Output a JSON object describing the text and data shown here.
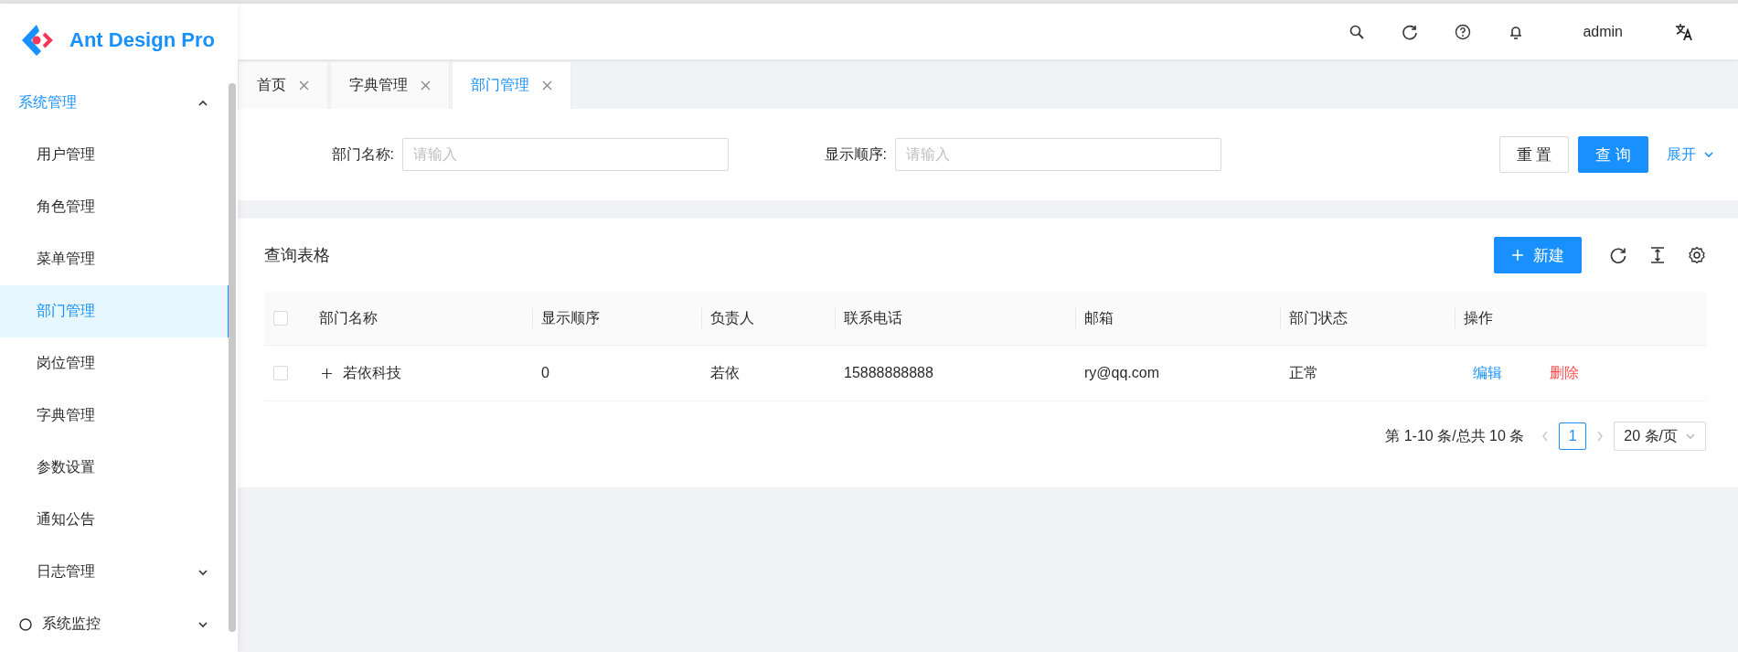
{
  "sidebar": {
    "logo_text": "Ant Design Pro",
    "menu": [
      {
        "label": "系统管理",
        "expanded": true,
        "children": [
          {
            "label": "用户管理",
            "selected": false
          },
          {
            "label": "角色管理",
            "selected": false
          },
          {
            "label": "菜单管理",
            "selected": false
          },
          {
            "label": "部门管理",
            "selected": true
          },
          {
            "label": "岗位管理",
            "selected": false
          },
          {
            "label": "字典管理",
            "selected": false
          },
          {
            "label": "参数设置",
            "selected": false
          },
          {
            "label": "通知公告",
            "selected": false
          },
          {
            "label": "日志管理",
            "selected": false,
            "expanded": false
          }
        ]
      },
      {
        "label": "系统监控",
        "expanded": false
      }
    ]
  },
  "header": {
    "user": "admin"
  },
  "tabs": [
    {
      "label": "首页",
      "selected": false
    },
    {
      "label": "字典管理",
      "selected": false
    },
    {
      "label": "部门管理",
      "selected": true
    }
  ],
  "search_form": {
    "fields": [
      {
        "label": "部门名称:",
        "placeholder": "请输入"
      },
      {
        "label": "显示顺序:",
        "placeholder": "请输入"
      }
    ],
    "reset_button": "重 置",
    "query_button": "查 询",
    "expand_link": "展开"
  },
  "table_card": {
    "title": "查询表格",
    "new_button": "新建",
    "columns": [
      "部门名称",
      "显示顺序",
      "负责人",
      "联系电话",
      "邮箱",
      "部门状态",
      "操作"
    ],
    "header_checked": false,
    "rows": [
      {
        "checked": false,
        "expanded": false,
        "cells": [
          "若依科技",
          "0",
          "若依",
          "15888888888",
          "ry@qq.com",
          "正常"
        ],
        "actions": [
          {
            "label": "编辑",
            "kind": "edit"
          },
          {
            "label": "删除",
            "kind": "delete"
          }
        ]
      }
    ],
    "pagination": {
      "summary": "第 1-10 条/总共 10 条",
      "prev_disabled": true,
      "next_disabled": true,
      "pages": [
        {
          "label": "1",
          "selected": true
        }
      ],
      "page_size": "20 条/页"
    }
  }
}
